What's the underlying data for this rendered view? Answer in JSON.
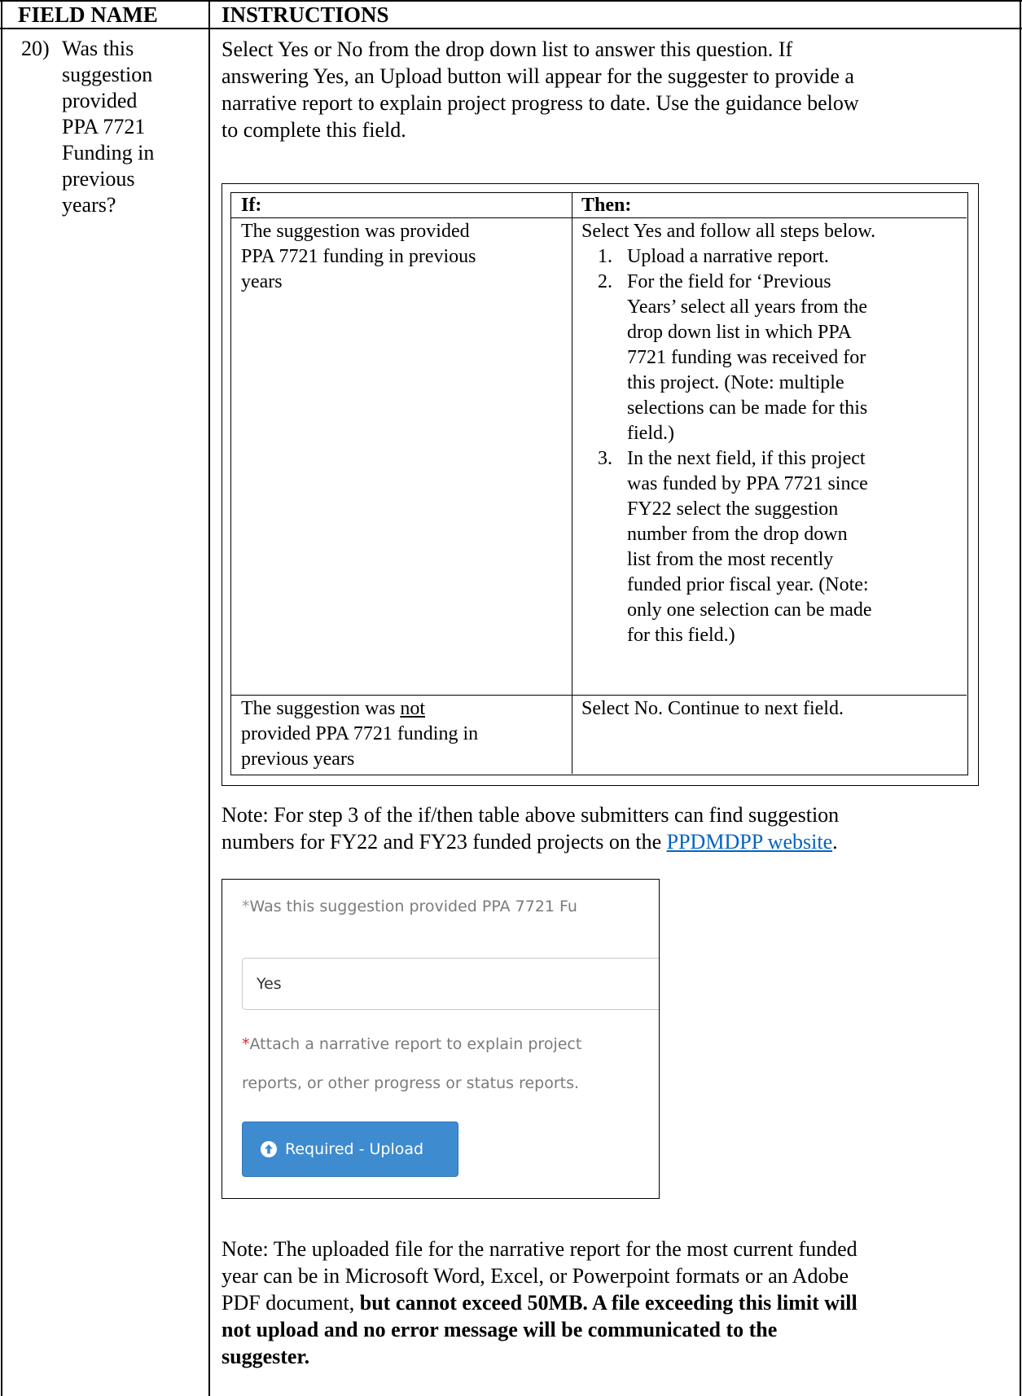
{
  "header": {
    "col1": "FIELD NAME",
    "col2": "INSTRUCTIONS"
  },
  "field": {
    "number": "20)",
    "lines": [
      "Was this",
      "suggestion",
      "provided",
      "PPA 7721",
      "Funding in",
      "previous",
      "years?"
    ]
  },
  "intro": [
    "Select Yes or No from the drop down list to answer this question. If",
    "answering Yes, an Upload button will appear for the suggester to provide a",
    "narrative report to explain project progress to date. Use the guidance below",
    "to complete this field."
  ],
  "if_then_table": {
    "if_header": "If:",
    "then_header": "Then:",
    "row1_if": [
      "The suggestion was provided",
      "PPA 7721 funding in previous",
      "years"
    ],
    "row1_then_intro": "Select Yes and follow all steps below.",
    "steps": [
      {
        "num": "1.",
        "lines": [
          "Upload a narrative report."
        ]
      },
      {
        "num": "2.",
        "lines": [
          "For the field for ‘Previous",
          "Years’ select all years from the",
          "drop down list in which PPA",
          "7721 funding was received for",
          "this project. (Note: multiple",
          "selections can be made for this",
          "field.)"
        ]
      },
      {
        "num": "3.",
        "lines": [
          "In the next field, if this project",
          "was funded by PPA 7721 since",
          "FY22 select the suggestion",
          "number from the drop down",
          "list from the most recently",
          "funded prior fiscal year. (Note:",
          "only one selection can be made",
          "for this field.)"
        ]
      }
    ],
    "row2_if_prefix": "The suggestion was ",
    "row2_if_underlined": "not",
    "row2_if_rest": [
      "provided PPA 7721 funding in",
      "previous years"
    ],
    "row2_then": "Select No. Continue to next field."
  },
  "note1": {
    "line1": "Note: For step 3 of the if/then table above submitters can find suggestion",
    "line2_prefix": "numbers for FY22 and FY23 funded projects on the ",
    "link_text": "PPDMDPP website",
    "line2_suffix": "."
  },
  "screenshot": {
    "question_label": "Was this suggestion provided PPA 7721 Fu",
    "selected_value": "Yes",
    "attach_label_line1": "Attach a narrative report to explain project",
    "attach_label_line2": "reports, or other progress or status reports.",
    "upload_button": "Required - Upload",
    "required_star": "*",
    "accent_color": "#3e8bd0",
    "star_color": "#d62b2b"
  },
  "note2": {
    "line1": "Note: The uploaded file for the narrative report for the most current funded",
    "line2": "year can be in Microsoft Word, Excel, or Powerpoint formats or an Adobe",
    "line3_normal": "PDF document, ",
    "line3_bold": "but cannot exceed 50MB. A file exceeding this limit will",
    "line4_bold": "not upload and no error message will be communicated to the",
    "line5_bold": "suggester."
  }
}
